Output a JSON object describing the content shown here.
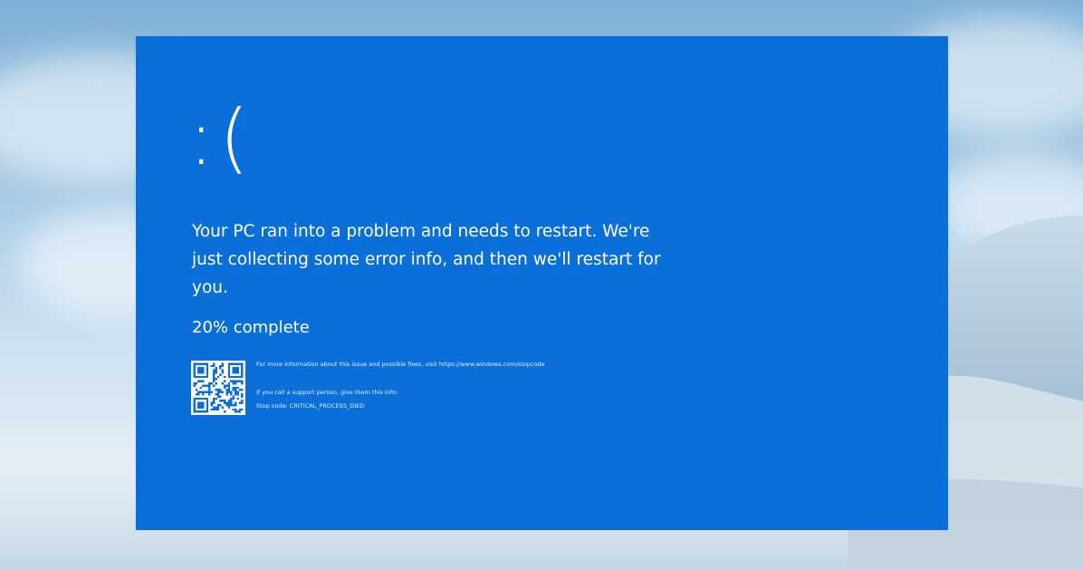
{
  "screen": {
    "background_color": "#0a6fd9",
    "sad_face": ":(",
    "message": "Your PC ran into a problem and needs to restart. We're just collecting some error info, and then we'll restart for you.",
    "progress_text": "20% complete",
    "progress_percent": 20,
    "info_url_line": "For more information about this issue and possible fixes, visit https://www.windows.com/stopcode",
    "support_line": "If you call a support person, give them this info:",
    "stop_code_line": "Stop code: CRITICAL_PROCESS_DIED",
    "qr_icon": "qr-code-icon"
  },
  "backdrop": {
    "sky_color": "#a9cbe6",
    "snow_color": "#e6eef5"
  }
}
